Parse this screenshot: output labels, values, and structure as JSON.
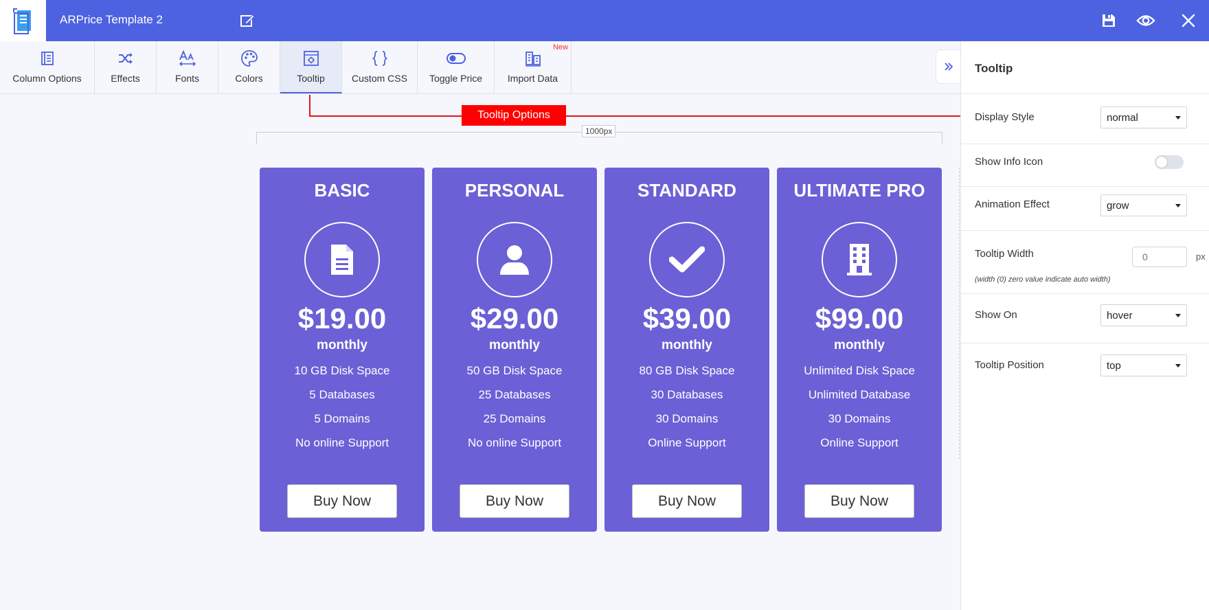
{
  "app": {
    "title": "ARPrice Template 2"
  },
  "toolbar": {
    "items": [
      {
        "label": "Column Options"
      },
      {
        "label": "Effects"
      },
      {
        "label": "Fonts"
      },
      {
        "label": "Colors"
      },
      {
        "label": "Tooltip",
        "active": true
      },
      {
        "label": "Custom CSS"
      },
      {
        "label": "Toggle Price"
      },
      {
        "label": "Import Data",
        "badge": "New"
      }
    ]
  },
  "annotation": {
    "label": "Tooltip Options"
  },
  "ruler": {
    "label": "1000px"
  },
  "cards": [
    {
      "title": "BASIC",
      "icon": "document-icon",
      "price": "$19.00",
      "period": "monthly",
      "features": [
        "10 GB Disk Space",
        "5 Databases",
        "5 Domains",
        "No online Support"
      ],
      "button": "Buy Now"
    },
    {
      "title": "PERSONAL",
      "icon": "user-icon",
      "price": "$29.00",
      "period": "monthly",
      "features": [
        "50 GB Disk Space",
        "25 Databases",
        "25 Domains",
        "No online Support"
      ],
      "button": "Buy Now"
    },
    {
      "title": "STANDARD",
      "icon": "checkmark-icon",
      "price": "$39.00",
      "period": "monthly",
      "features": [
        "80 GB Disk Space",
        "30 Databases",
        "30 Domains",
        "Online Support"
      ],
      "button": "Buy Now"
    },
    {
      "title": "ULTIMATE PRO",
      "icon": "building-icon",
      "price": "$99.00",
      "period": "monthly",
      "features": [
        "Unlimited Disk Space",
        "Unlimited Database",
        "30 Domains",
        "Online Support"
      ],
      "button": "Buy Now"
    }
  ],
  "panel": {
    "title": "Tooltip",
    "display_style": {
      "label": "Display Style",
      "value": "normal"
    },
    "show_info_icon": {
      "label": "Show Info Icon",
      "enabled": false
    },
    "animation_effect": {
      "label": "Animation Effect",
      "value": "grow"
    },
    "tooltip_width": {
      "label": "Tooltip Width",
      "value": "0",
      "unit": "px",
      "note": "(width (0) zero value indicate auto width)"
    },
    "show_on": {
      "label": "Show On",
      "value": "hover"
    },
    "tooltip_position": {
      "label": "Tooltip Position",
      "value": "top"
    }
  },
  "colors": {
    "header": "#4d62e0",
    "card": "#6c60d6",
    "annotation": "#ff0000",
    "background": "#f5f7fc"
  }
}
